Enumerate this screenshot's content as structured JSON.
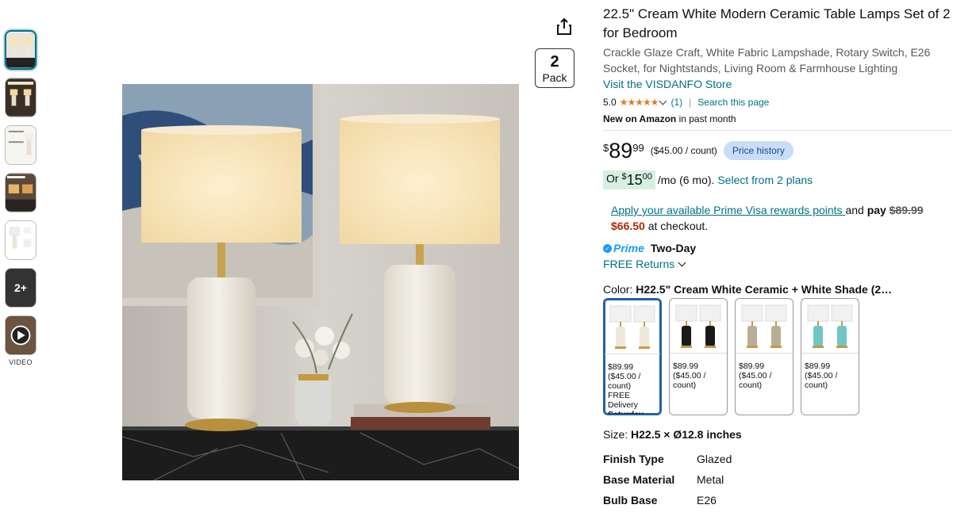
{
  "thumbnails": {
    "more_label": "2+",
    "video_label": "VIDEO"
  },
  "pack": {
    "number": "2",
    "label": "Pack"
  },
  "product": {
    "title": "22.5\" Cream White Modern Ceramic Table Lamps Set of 2 for Bedroom",
    "subtitle": "Crackle Glaze Craft, White Fabric Lampshade, Rotary Switch, E26 Socket, for Nightstands, Living Room & Farmhouse Lighting",
    "store_link": "Visit the VISDANFO Store",
    "rating": "5.0",
    "stars": "★★★★★",
    "review_count": "(1)",
    "search_page": "Search this page",
    "new_bold": "New on Amazon",
    "new_rest": " in past month"
  },
  "price": {
    "currency": "$",
    "whole": "89",
    "fraction": "99",
    "per_unit": "($45.00 / count)",
    "history_btn": "Price history"
  },
  "monthly": {
    "or": "Or ",
    "currency": "$",
    "whole": "15",
    "fraction": "00",
    "rest": " /mo (6 mo). ",
    "plans_link": "Select from 2 plans"
  },
  "visa": {
    "link": "Apply your available Prime Visa rewards points ",
    "and": "and ",
    "pay": "pay ",
    "old_price": "$89.99",
    "new_price": "$66.50",
    "checkout": " at checkout."
  },
  "prime": {
    "label": "Prime",
    "speed": "Two-Day",
    "returns": "FREE Returns"
  },
  "color": {
    "label": "Color: ",
    "value": "H22.5\" Cream White Ceramic + White Shade (2…",
    "options": [
      {
        "price": "$89.99",
        "unit": "($45.00 /",
        "unit2": "count)",
        "delivery": "FREE Delivery",
        "day": "Saturday",
        "base_color": "#efe8d8"
      },
      {
        "price": "$89.99",
        "unit": "($45.00 /",
        "unit2": "count)",
        "delivery": "",
        "day": "",
        "base_color": "#1a1a1a"
      },
      {
        "price": "$89.99",
        "unit": "($45.00 /",
        "unit2": "count)",
        "delivery": "",
        "day": "",
        "base_color": "#b8ad97"
      },
      {
        "price": "$89.99",
        "unit": "($45.00 /",
        "unit2": "count)",
        "delivery": "",
        "day": "",
        "base_color": "#6fc7c4"
      }
    ]
  },
  "size": {
    "label": "Size: ",
    "value": "H22.5 × Ø12.8 inches"
  },
  "attributes": [
    {
      "key": "Finish Type",
      "value": "Glazed"
    },
    {
      "key": "Base Material",
      "value": "Metal"
    },
    {
      "key": "Bulb Base",
      "value": "E26"
    }
  ]
}
